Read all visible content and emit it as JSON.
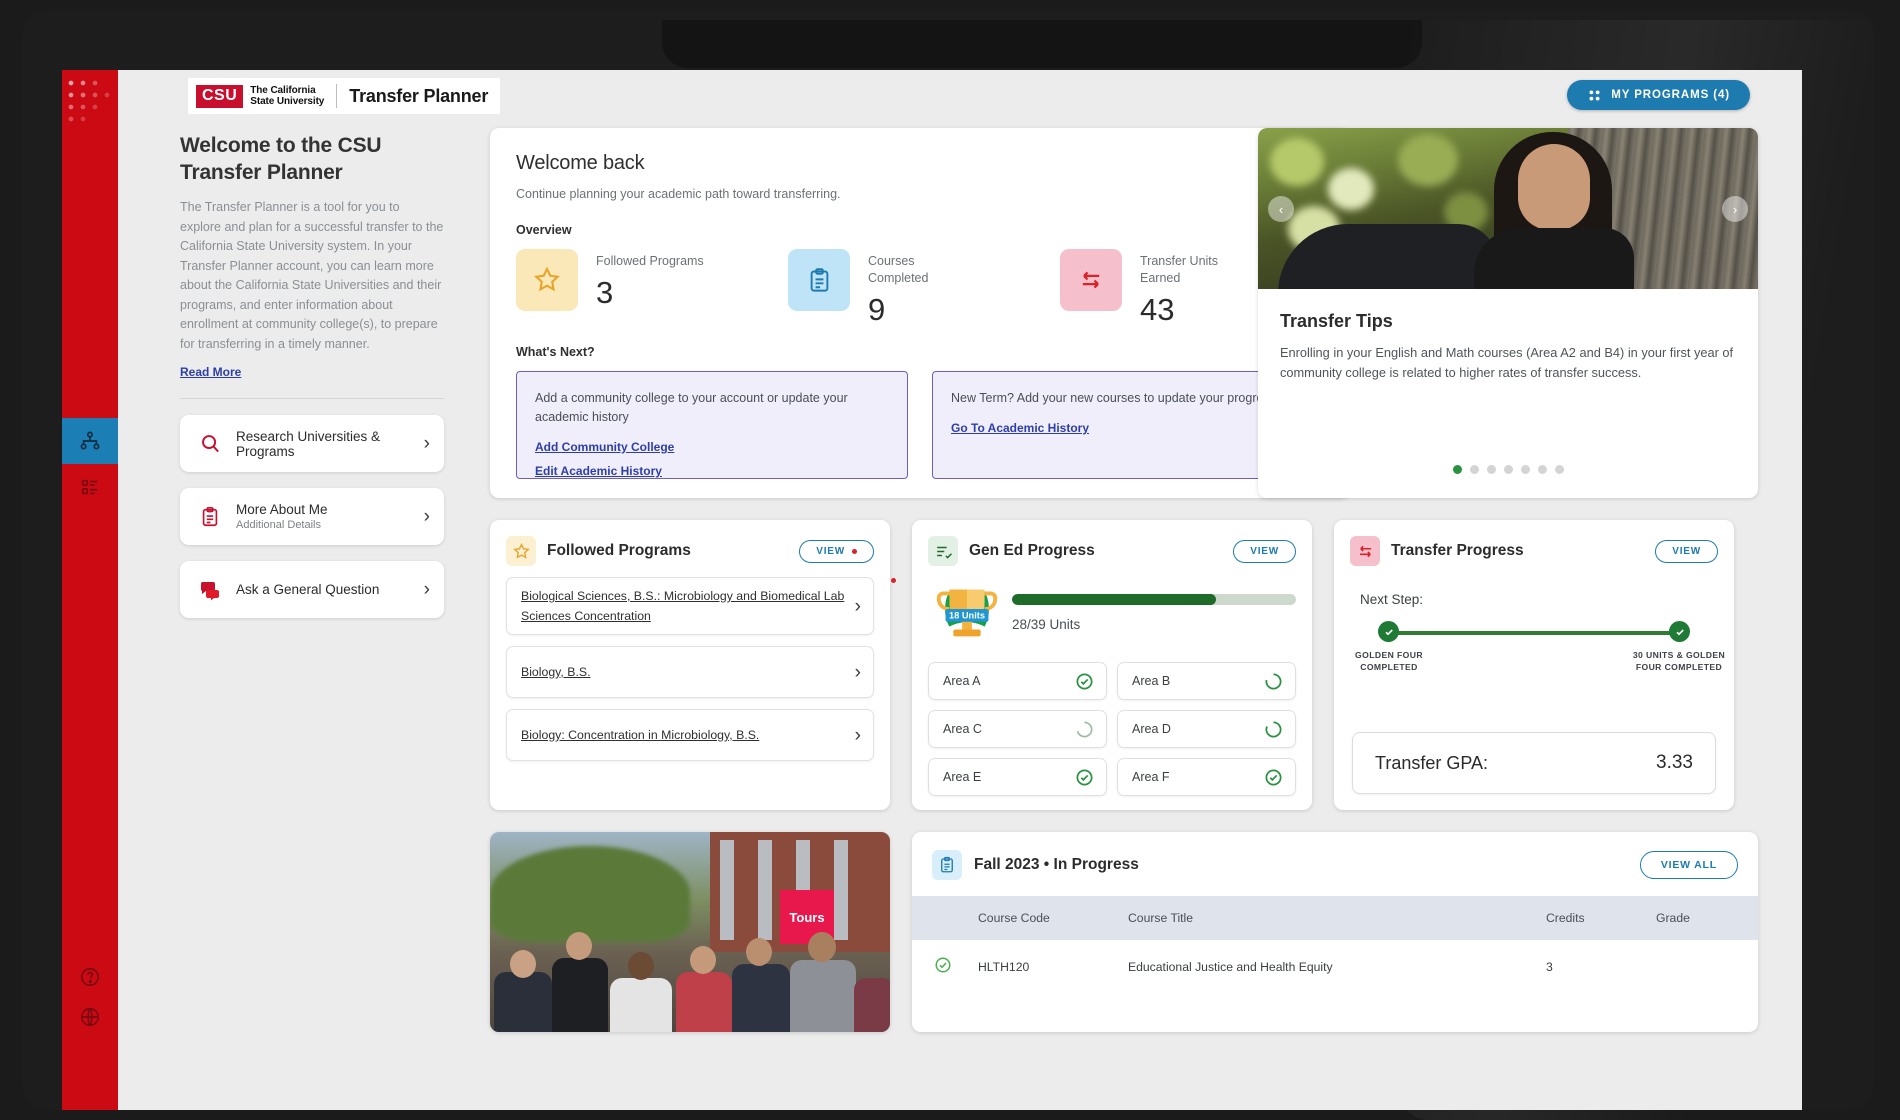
{
  "header": {
    "logo_mark": "CSU",
    "logo_line1": "The California",
    "logo_line2": "State University",
    "app_title": "Transfer Planner",
    "my_programs_label": "MY PROGRAMS (4)",
    "my_programs_icon": "grid-icon",
    "accent_blue": "#1e7bb0",
    "brand_red": "#cc0a14"
  },
  "rail": {
    "items": [
      {
        "name": "network-icon",
        "active": true
      },
      {
        "name": "list-icon",
        "active": false
      },
      {
        "name": "help-icon",
        "active": false
      },
      {
        "name": "globe-icon",
        "active": false
      }
    ]
  },
  "left": {
    "title": "Welcome to the CSU Transfer Planner",
    "body": "The Transfer Planner is a tool for you to explore and plan for a successful transfer to the California State University system. In your Transfer Planner account, you can learn more about the California State Universities and their programs, and enter information about enrollment at community college(s), to prepare for transferring in a timely manner.",
    "read_more": "Read More",
    "nav_cards": [
      {
        "icon": "search-icon",
        "label": "Research Universities & Programs",
        "sub": ""
      },
      {
        "icon": "clipboard-icon",
        "label": "More About Me",
        "sub": "Additional Details"
      },
      {
        "icon": "chat-bubbles-icon",
        "label": "Ask a General Question",
        "sub": ""
      }
    ]
  },
  "welcome_panel": {
    "title": "Welcome back",
    "subtitle": "Continue planning your academic path toward transferring.",
    "overview_label": "Overview",
    "stats": [
      {
        "icon": "star-icon",
        "icon_bg": "#fbe8b8",
        "icon_color": "#e8a52c",
        "label": "Followed Programs",
        "value": "3"
      },
      {
        "icon": "clipboard-icon",
        "icon_bg": "#bfe4f7",
        "icon_color": "#1e7bb0",
        "label": "Courses Completed",
        "value": "9"
      },
      {
        "icon": "transfer-arrows-icon",
        "icon_bg": "#f5c0cc",
        "icon_color": "#d8232a",
        "label": "Transfer Units Earned",
        "value": "43"
      }
    ],
    "whats_next_label": "What's Next?",
    "whats_next": [
      {
        "text": "Add a community college to your account or update your academic history",
        "links": [
          "Add Community College",
          "Edit Academic History"
        ]
      },
      {
        "text": "New Term? Add your new courses to update your progress.",
        "links": [
          "Go To Academic History"
        ]
      }
    ]
  },
  "tips": {
    "title": "Transfer Tips",
    "text": "Enrolling in your English and Math courses (Area A2 and B4) in your first year of community college is related to higher rates of transfer success.",
    "dot_count": 7,
    "active_dot": 0,
    "prev_icon": "chevron-left-icon",
    "next_icon": "chevron-right-icon"
  },
  "followed_programs": {
    "icon": "star-icon",
    "title": "Followed Programs",
    "view_label": "VIEW",
    "has_badge": true,
    "items": [
      "Biological Sciences, B.S.: Microbiology and Biomedical Lab Sciences Concentration",
      "Biology, B.S.",
      "Biology: Concentration in Microbiology, B.S."
    ]
  },
  "gen_ed": {
    "icon": "checklist-icon",
    "title": "Gen Ed Progress",
    "view_label": "VIEW",
    "trophy_badge": "18 Units",
    "units_text": "28/39 Units",
    "units_completed": 28,
    "units_total": 39,
    "areas": [
      {
        "label": "Area A",
        "status": "complete"
      },
      {
        "label": "Area B",
        "status": "partial"
      },
      {
        "label": "Area C",
        "status": "partial"
      },
      {
        "label": "Area D",
        "status": "partial"
      },
      {
        "label": "Area E",
        "status": "complete"
      },
      {
        "label": "Area F",
        "status": "complete"
      }
    ]
  },
  "transfer_progress": {
    "icon": "transfer-arrows-icon",
    "title": "Transfer Progress",
    "view_label": "VIEW",
    "next_step_label": "Next Step:",
    "milestones": [
      {
        "caption": "GOLDEN FOUR COMPLETED",
        "complete": true
      },
      {
        "caption": "30 UNITS & GOLDEN FOUR COMPLETED",
        "complete": true
      }
    ],
    "gpa_label": "Transfer GPA:",
    "gpa_value": "3.33"
  },
  "tour_photo": {
    "sign_text": "Tours"
  },
  "term": {
    "icon": "clipboard-icon",
    "title": "Fall 2023 • In Progress",
    "view_all_label": "VIEW ALL",
    "columns": [
      "Course Code",
      "Course Title",
      "Credits",
      "Grade"
    ],
    "rows": [
      {
        "status": "complete",
        "code": "HLTH120",
        "title": "Educational Justice and Health Equity",
        "credits": "3",
        "grade": ""
      }
    ]
  }
}
